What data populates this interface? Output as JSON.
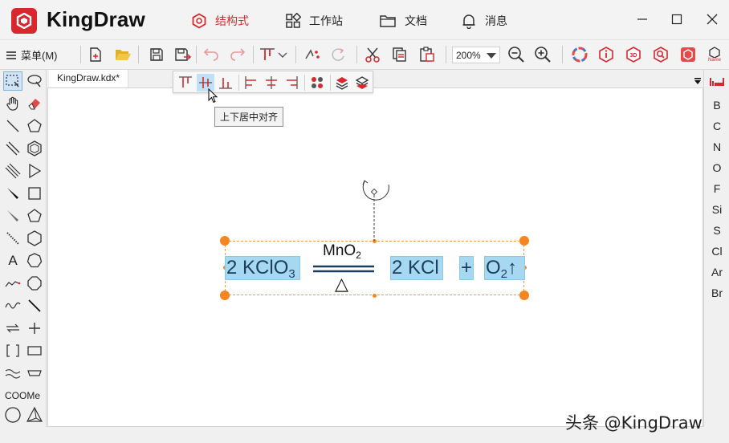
{
  "app": {
    "name": "KingDraw",
    "brand_color": "#d7282d"
  },
  "nav_tabs": [
    {
      "label": "结构式",
      "icon": "hexagon-icon",
      "active": true
    },
    {
      "label": "工作站",
      "icon": "grid-apps-icon",
      "active": false
    },
    {
      "label": "文档",
      "icon": "folder-icon",
      "active": false
    },
    {
      "label": "消息",
      "icon": "bell-icon",
      "active": false
    }
  ],
  "toolbar": {
    "menu_label": "菜单(M)",
    "zoom_value": "200%",
    "name_badge": "Name"
  },
  "document": {
    "tab_label": "KingDraw.kdx*"
  },
  "left_tools": {
    "coome_label": "COOMe",
    "text_label": "A"
  },
  "align_popup": {
    "tooltip": "上下居中对齐"
  },
  "reaction": {
    "reactant_coef": "2",
    "reactant_formula": "KClO",
    "reactant_sub": "3",
    "catalyst": "MnO",
    "catalyst_sub": "2",
    "condition": "△",
    "product1_coef": "2",
    "product1_formula": "KCl",
    "plus": "+",
    "product2_formula": "O",
    "product2_sub": "2",
    "product2_arrow": "↑"
  },
  "elements": [
    "B",
    "C",
    "N",
    "O",
    "F",
    "Si",
    "S",
    "Cl",
    "Ar",
    "Br"
  ],
  "watermark": "头条 @KingDraw",
  "colors": {
    "selection_fill": "#a7d8f2",
    "handle": "#f5851f",
    "accent": "#d7282d"
  }
}
